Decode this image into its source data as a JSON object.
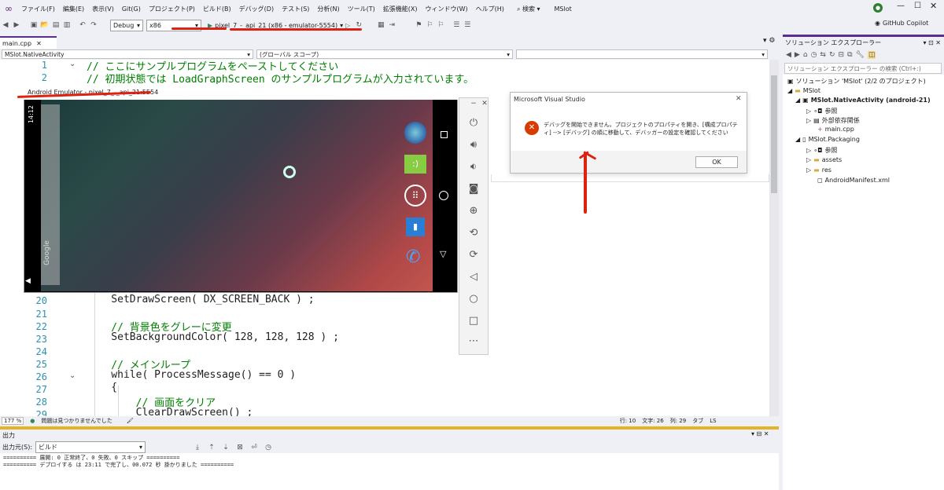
{
  "menu": {
    "items": [
      "ファイル(F)",
      "編集(E)",
      "表示(V)",
      "Git(G)",
      "プロジェクト(P)",
      "ビルド(B)",
      "デバッグ(D)",
      "テスト(S)",
      "分析(N)",
      "ツール(T)",
      "拡張機能(X)",
      "ウィンドウ(W)",
      "ヘルプ(H)"
    ],
    "search": "検索",
    "solution_name": "MSlot",
    "copilot": "GitHub Copilot"
  },
  "toolbar": {
    "config": "Debug",
    "platform": "x86",
    "target": "pixel_7_-_api_21 (x86 - emulator-5554)"
  },
  "editor": {
    "tab": "main.cpp",
    "nav_left": "MSlot.NativeActivity",
    "nav_mid": "(グローバル スコープ)",
    "lines": [
      {
        "n": "1",
        "t": "// ここにサンプルプログラムをペーストしてください",
        "c": "cm"
      },
      {
        "n": "2",
        "t": "// 初期状態では LoadGraphScreen のサンプルプログラムが入力されています。",
        "c": "cm"
      },
      {
        "n": "20",
        "t": "    SetDrawScreen( DX_SCREEN_BACK ) ;",
        "c": ""
      },
      {
        "n": "21",
        "t": "",
        "c": ""
      },
      {
        "n": "22",
        "t": "    // 背景色をグレーに変更",
        "c": "cm"
      },
      {
        "n": "23",
        "t": "    SetBackgroundColor( 128, 128, 128 ) ;",
        "c": ""
      },
      {
        "n": "24",
        "t": "",
        "c": ""
      },
      {
        "n": "25",
        "t": "    // メインループ",
        "c": "cm"
      },
      {
        "n": "26",
        "t": "    while( ProcessMessage() == 0 )",
        "c": "kw"
      },
      {
        "n": "27",
        "t": "    {",
        "c": ""
      },
      {
        "n": "28",
        "t": "        // 画面をクリア",
        "c": "cm"
      },
      {
        "n": "29",
        "t": "        ClearDrawScreen() ;",
        "c": ""
      }
    ]
  },
  "status": {
    "zoom": "177 %",
    "issues": "問題は見つかりませんでした",
    "line": "行: 10",
    "char": "文字: 26",
    "col": "列: 29",
    "tab": "タブ",
    "eol": "LS"
  },
  "output": {
    "title": "出力",
    "source_label": "出力元(S):",
    "source": "ビルド",
    "lines": [
      "========== 展開: 0 正常終了、0 失敗、0 スキップ ==========",
      "========== デプロイする は 23:11 で完了し、00.072 秒 掛かりました =========="
    ]
  },
  "solution_explorer": {
    "title": "ソリューション エクスプローラー",
    "search_placeholder": "ソリューション エクスプローラー の検索 (Ctrl+:)",
    "nodes": [
      {
        "label": "ソリューション 'MSlot' (2/2 のプロジェクト)",
        "bold": false
      },
      {
        "label": "MSlot",
        "bold": false
      },
      {
        "label": "MSlot.NativeActivity (android-21)",
        "bold": true
      },
      {
        "label": "参照",
        "bold": false
      },
      {
        "label": "外部依存関係",
        "bold": false
      },
      {
        "label": "main.cpp",
        "bold": false
      },
      {
        "label": "MSlot.Packaging",
        "bold": false
      },
      {
        "label": "参照",
        "bold": false
      },
      {
        "label": "assets",
        "bold": false
      },
      {
        "label": "res",
        "bold": false
      },
      {
        "label": "AndroidManifest.xml",
        "bold": false
      }
    ]
  },
  "emulator": {
    "title": "Android Emulator - pixel_7_-_api_21:5554",
    "clock": "14:12",
    "google": "Google"
  },
  "dialog": {
    "title": "Microsoft Visual Studio",
    "message": "デバッグを開始できません。プロジェクトのプロパティを開き、[構成プロパティ] --> [デバッグ] の順に移動して、デバッガーの設定を確認してください",
    "ok": "OK"
  },
  "colors": {
    "accent": "#5c2d91",
    "annotation": "#dd1111",
    "error": "#d83b01"
  }
}
